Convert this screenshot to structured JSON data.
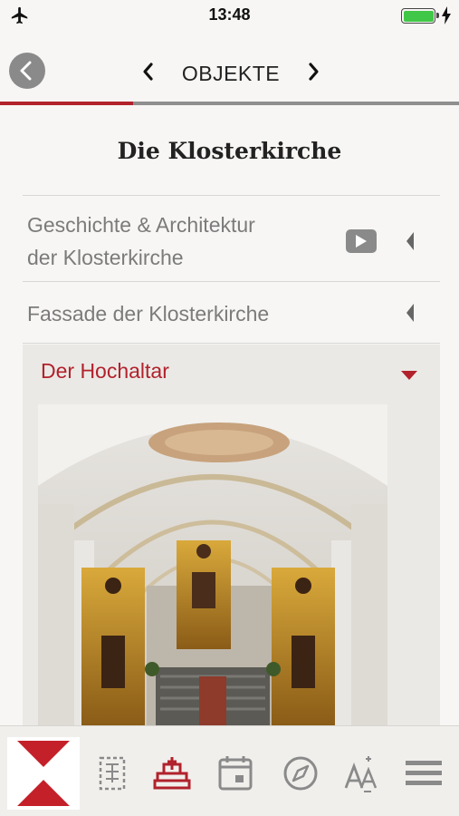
{
  "status_bar": {
    "time": "13:48",
    "airplane_icon": "airplane-icon",
    "battery_color": "#41c747",
    "charging_icon": "bolt-icon"
  },
  "nav": {
    "title": "OBJEKTE",
    "back_icon": "chevron-left-circle-icon",
    "prev_icon": "chevron-left-icon",
    "next_icon": "chevron-right-icon",
    "progress_fraction": 0.29
  },
  "page": {
    "title": "Die Klosterkirche"
  },
  "items": [
    {
      "label_line1": "Geschichte & Architektur",
      "label_line2": "der Klosterkirche",
      "has_video": true,
      "expanded": false
    },
    {
      "label_line1": "Fassade der Klosterkirche",
      "has_video": false,
      "expanded": false
    },
    {
      "label_line1": "Der Hochaltar",
      "expanded": true,
      "image": "church-interior-high-altar-photo"
    }
  ],
  "colors": {
    "accent": "#b1222c",
    "muted_text": "#7b7b7b",
    "icon_gray": "#8a8a8a"
  },
  "tabbar": {
    "logo": "red-x-logo",
    "tabs": [
      {
        "icon": "floorplan-icon",
        "active": false
      },
      {
        "icon": "altar-icon",
        "active": true
      },
      {
        "icon": "calendar-icon",
        "active": false
      },
      {
        "icon": "compass-icon",
        "active": false
      },
      {
        "icon": "font-size-icon",
        "active": false
      },
      {
        "icon": "menu-icon",
        "active": false
      }
    ]
  }
}
